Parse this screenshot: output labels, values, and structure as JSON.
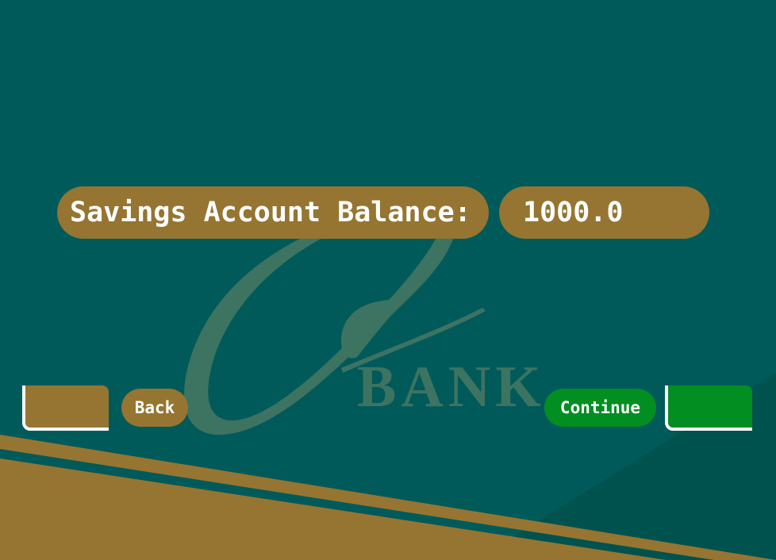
{
  "balance": {
    "label": "Savings Account Balance:",
    "value": "1000.0"
  },
  "watermark": {
    "text": "BANK"
  },
  "buttons": {
    "back_label": "Back",
    "continue_label": "Continue"
  },
  "colors": {
    "background": "#005a5a",
    "gold": "#957531",
    "green": "#038e22",
    "watermark": "#3d7361"
  }
}
